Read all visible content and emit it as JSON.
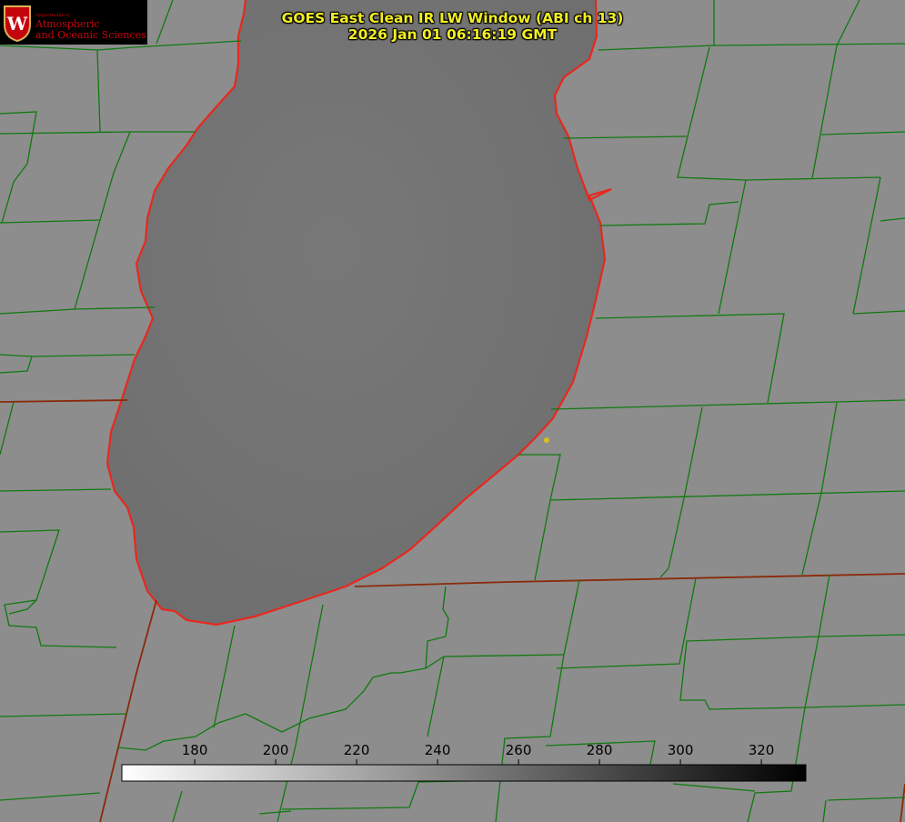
{
  "header": {
    "title": "GOES East Clean IR LW Window (ABI ch 13)",
    "timestamp": "2026 Jan 01 06:16:19 GMT"
  },
  "logo": {
    "department": "Department of",
    "line1": "Atmospheric",
    "line2": "and Oceanic Sciences",
    "crest_letter": "W"
  },
  "colorbar": {
    "ticks": [
      "180",
      "200",
      "220",
      "240",
      "260",
      "280",
      "300",
      "320"
    ],
    "tick_values": [
      180,
      200,
      220,
      240,
      260,
      280,
      300,
      320
    ],
    "range": [
      162,
      331
    ],
    "colormap": "white (cold) to black (warm) grayscale"
  },
  "map": {
    "colors": {
      "land": "#8c8c8c",
      "lake_shading": "#707070",
      "county_lines": "#0f7a0f",
      "state_lines": "#8a2a0a",
      "coastline": "#e8281e",
      "marker": "#d6c21a"
    }
  }
}
